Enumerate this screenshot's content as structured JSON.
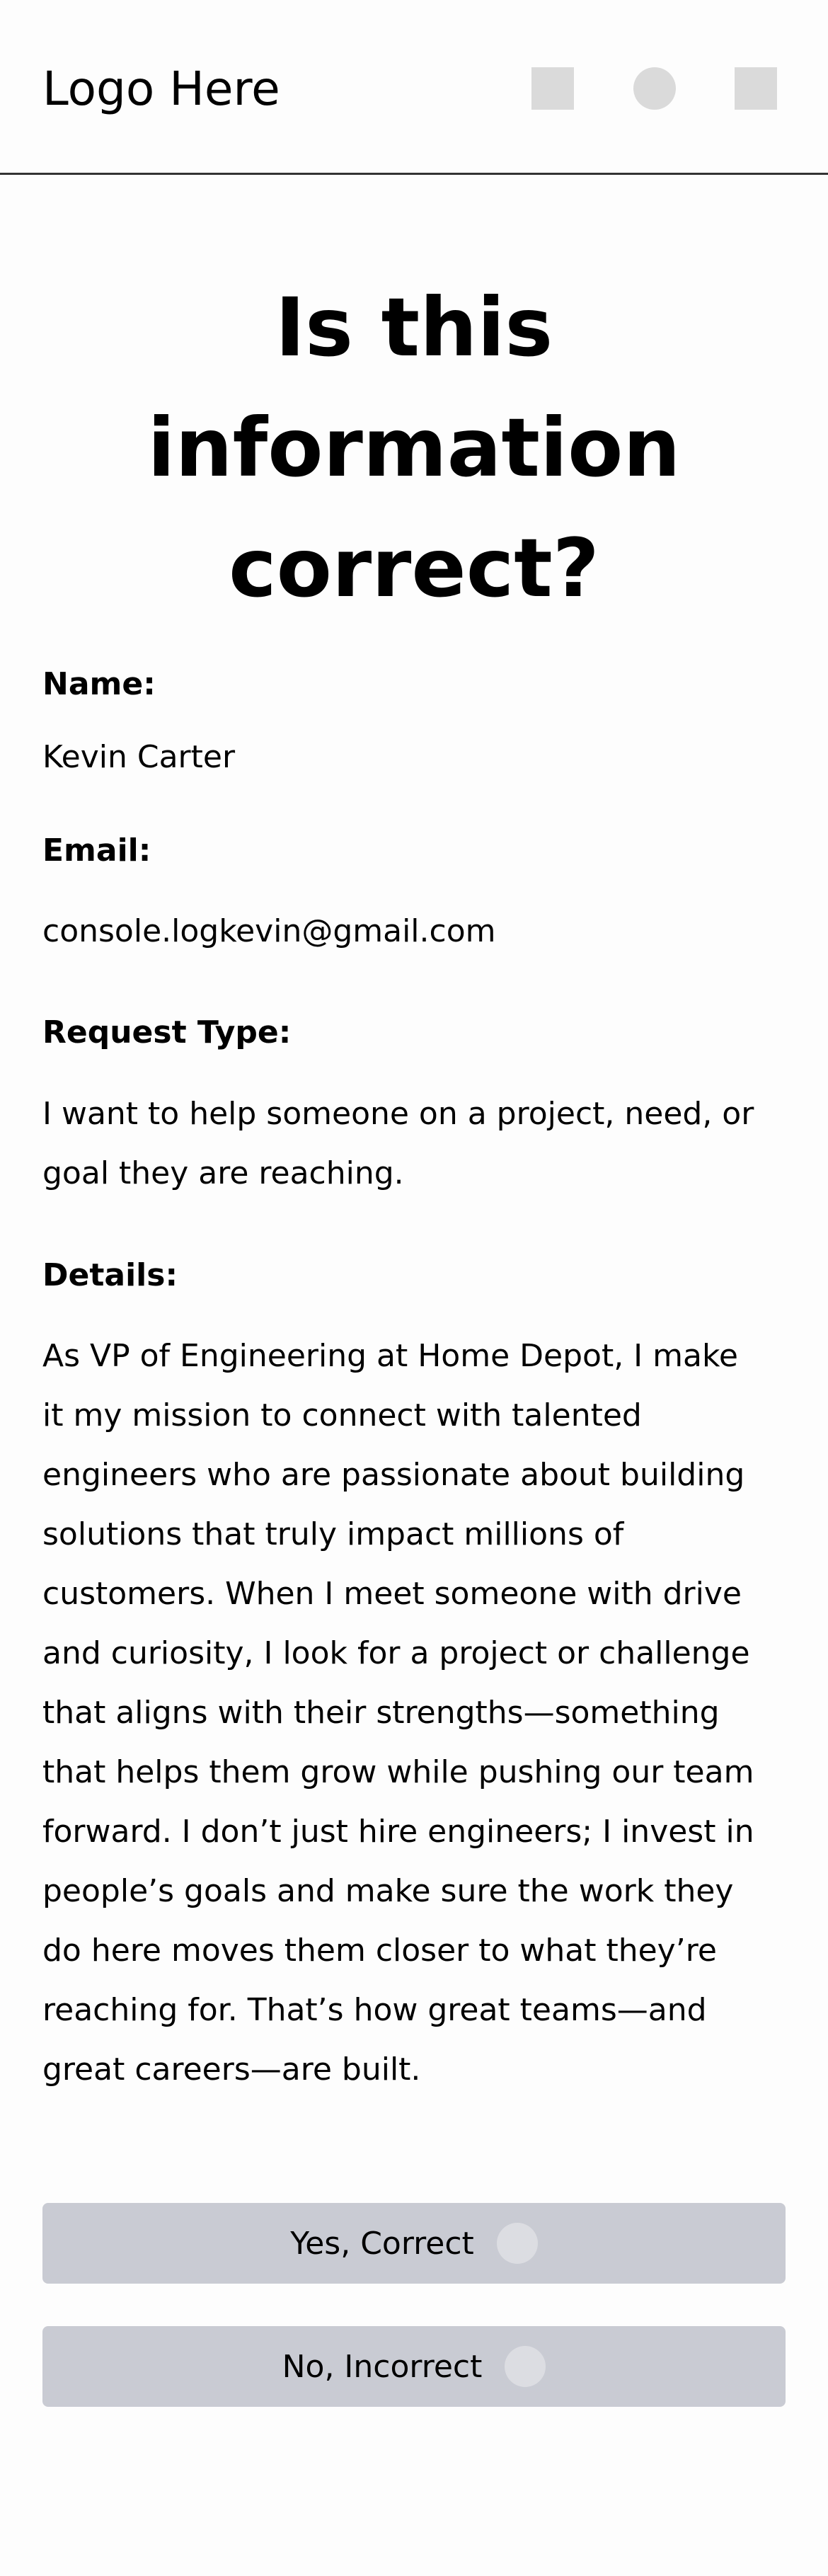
{
  "header": {
    "logo_text": "Logo Here",
    "icons": [
      "square-icon",
      "circle-icon",
      "square-icon"
    ]
  },
  "title": "Is this information correct?",
  "fields": {
    "name": {
      "label": "Name:",
      "value": "Kevin Carter"
    },
    "email": {
      "label": "Email:",
      "value": "console.logkevin@gmail.com"
    },
    "request_type": {
      "label": "Request Type:",
      "value": "I want to help someone on a project, need, or goal they are reaching."
    },
    "details": {
      "label": "Details:",
      "value": "As VP of Engineering at Home Depot, I make it my mission to connect with talented engineers who are passionate about building solutions that truly impact millions of customers. When I meet someone with drive and curiosity, I look for a project or challenge that aligns with their strengths—something that helps them grow while pushing our team forward. I don’t just hire engineers; I invest in people’s goals and make sure the work they do here moves them closer to what they’re reaching for. That’s how great teams—and great careers—are built."
    }
  },
  "buttons": {
    "yes_label": "Yes, Correct",
    "no_label": "No, Incorrect"
  },
  "colors": {
    "button_bg": "#c9cbd3",
    "icon_placeholder": "#dadada"
  }
}
